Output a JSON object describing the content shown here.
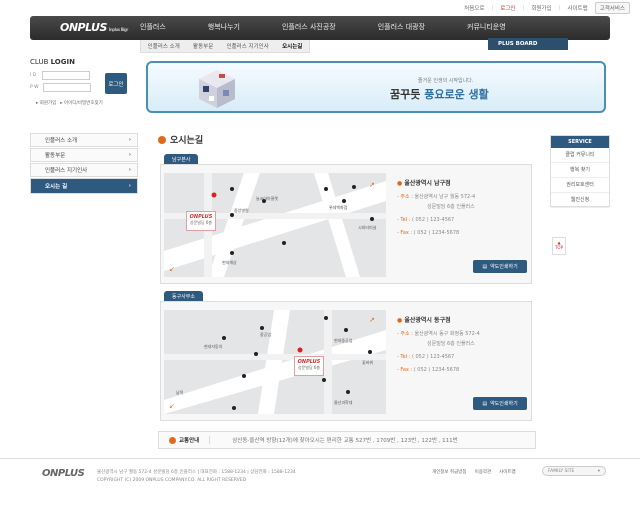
{
  "util": [
    "처음으로",
    "로그인",
    "회원가입",
    "사이트맵",
    "고객서비스"
  ],
  "logo": {
    "main": "ONPLUS",
    "small": "Inplus Bigr"
  },
  "menu": [
    "인플러스",
    "행복나누기",
    "인플러스 사진공장",
    "인플러스 대광장",
    "커뮤니티운영"
  ],
  "submenu": [
    "인플러스 소개",
    "활동부문",
    "인플러스 지기인사",
    "오시는길"
  ],
  "plus_board": "PLUS BOARD",
  "login": {
    "title_a": "CLUB ",
    "title_b": "LOGIN",
    "id_label": "I D",
    "pw_label": "P W",
    "button": "로그인",
    "join": "회원가입",
    "find": "아이디/비밀번호찾기"
  },
  "banner": {
    "sub": "즐거운 인생의 시작입니다.",
    "title_a": "꿈꾸듯 ",
    "title_b": "풍요로운 생활"
  },
  "side_menu": [
    "인플러스 소개",
    "활동부문",
    "인플러스 지기인사",
    "오시는 길"
  ],
  "page_title": "오시는길",
  "branches": [
    {
      "tab": "남구본사",
      "name_prefix": "울산광역시 ",
      "name": "남구점",
      "addr_label": "주소 :",
      "addr1": "울산광역시 남구 월동 572-4",
      "addr2": "성문빌딩 6층 인플러스",
      "tel_label": "Tel :",
      "tel": "( 052 ) 123-4567",
      "fax_label": "Fax :",
      "fax": "( 052 ) 1234-5678",
      "print": "약도인쇄하기",
      "pin_brand": "ONPLUS",
      "pin_text": "성문빌딩 6층",
      "pois": [
        "늘코아아울렛",
        "중앙병원",
        "롯데백화점",
        "시외터미널",
        "현대해상"
      ]
    },
    {
      "tab": "동구사무소",
      "name_prefix": "울산광역시 ",
      "name": "동구점",
      "addr_label": "주소 :",
      "addr1": "울산광역시 동구 화정동 572-4",
      "addr2": "성문빌딩 6층 인플러스",
      "tel_label": "Tel :",
      "tel": "( 052 ) 123-4567",
      "fax_label": "Fax :",
      "fax": "( 052 ) 1234-5678",
      "print": "약도인쇄하기",
      "pin_brand": "ONPLUS",
      "pin_text": "성문빌딩 6층",
      "pois": [
        "중공업",
        "현대중공업",
        "현대자동차",
        "남목",
        "꽃바위",
        "울산과학대"
      ]
    }
  ],
  "transit": {
    "label": "교통안내",
    "text": "삼산동-울산역 방향(12개)에 찾아오시는 편리한 교통 527번 , 1709번 , 123번 , 122번 , 111번"
  },
  "service": {
    "title": "SERVICE",
    "items": [
      "클럽 커뮤니티",
      "행복 찾기",
      "권리보호센터",
      "웹진신청"
    ]
  },
  "top": "TOP",
  "footer": {
    "logo": "ONPLUS",
    "line1": "울산광역시 남구 월동 572-4 성문빌딩 6층 인플러스 | 대표전화 : 1588-1234 | 상담전화 : 1588-1234",
    "line2": "COPYRIGHT (C) 2009 ONPLUS COMPANY.CO. ALL RIGHT RESERVED",
    "links": [
      "개인정보 취급방침",
      "이용약관",
      "사이트맵"
    ],
    "family": "FAMILY SITE"
  },
  "colors": {
    "primary": "#2f5a80",
    "accent": "#e06a1b",
    "nav": "#333333"
  }
}
